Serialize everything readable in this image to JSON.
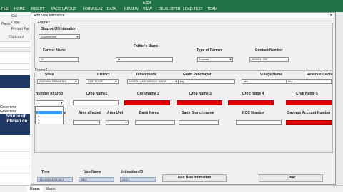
{
  "excel": {
    "title": "Excel",
    "ribbon_tabs": [
      "FILE",
      "HOME",
      "INSERT",
      "PAGE LAYOUT",
      "FORMULAS",
      "DATA",
      "REVIEW",
      "VIEW",
      "DEVELOPER",
      "LOAD TEST",
      "TEAM"
    ],
    "clipboard": {
      "cut": "Cut",
      "copy": "Copy",
      "format_painter": "Format Pai",
      "paste": "Paste",
      "group": "Clipboard"
    },
    "left_cells": {
      "row1": "Governme",
      "row2": "Governme",
      "navy_text": "Source of intimati on"
    },
    "sheet_tabs": [
      "Home",
      "Master"
    ]
  },
  "dialog": {
    "title": "Add New Intimation",
    "close": "✕",
    "frame1": {
      "label": "Frame1",
      "source_label": "Source Of Intimation",
      "source_value": "Government",
      "farmer_name_label": "Farmer Name",
      "farmer_name_value": "12",
      "fathers_name_label": "Father's Name",
      "fathers_name_value": "fff",
      "type_label": "Type of Farmer",
      "type_value": "Loanee",
      "contact_label": "Contact Number",
      "contact_value": "9896541230"
    },
    "frame2": {
      "label": "Frame2",
      "state_label": "State",
      "state_value": "ANDHRA PRADESH",
      "district_label": "District",
      "district_value": "CHITTOOR",
      "tehsil_label": "Tehsil/Block",
      "tehsil_value": "NORTH AND MIDDLE ANDA",
      "gram_label": "Gram Panchayat",
      "gram_value": "fdg",
      "village_label": "Village Name",
      "village_value": "fdd",
      "revenue_label": "Revenue Circle",
      "revenue_value": "fdd",
      "num_crop_label": "Number of Crop",
      "num_crop_value": "1",
      "num_crop_options": [
        "1",
        "2",
        "3",
        "4",
        "5"
      ],
      "crop1_label": "Crop Name1",
      "crop2_label": "Crop Name 2",
      "crop3_label": "Crop Name 3",
      "crop4_label": "Crop name 4",
      "crop5_label": "Crop Name 5",
      "land_label": "and",
      "area_affected_label": "Area affected",
      "area_unit_label": "Area Unit",
      "bank_name_label": "Bank Name",
      "bank_branch_label": "Bank Branch name",
      "kcc_label": "KCC Number",
      "savings_label": "Savings Account Number"
    },
    "footer": {
      "time_label": "Time",
      "time_value": "11/14/2018 12:45:1",
      "username_label": "UserName",
      "username_value": "SBO",
      "intimation_label": "Intimation ID",
      "intimation_value": "OCLT",
      "add_button": "Add New Intimation",
      "clear_button": "Clear"
    }
  }
}
